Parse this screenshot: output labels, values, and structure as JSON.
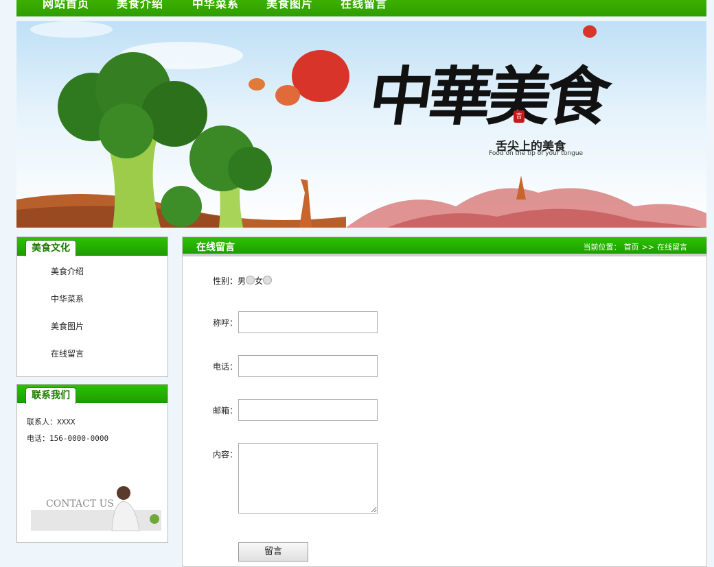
{
  "nav": {
    "items": [
      {
        "label": "网站首页"
      },
      {
        "label": "美食介绍"
      },
      {
        "label": "中华菜系"
      },
      {
        "label": "美食图片"
      },
      {
        "label": "在线留言"
      }
    ]
  },
  "banner": {
    "title": "中華美食",
    "subtitle": "舌尖上的美食",
    "tagline": "Food on the tip of your tongue",
    "seal": "吉"
  },
  "sidebar": {
    "culture": {
      "title": "美食文化",
      "items": [
        {
          "label": "美食介绍"
        },
        {
          "label": "中华菜系"
        },
        {
          "label": "美食图片"
        },
        {
          "label": "在线留言"
        }
      ]
    },
    "contact": {
      "title": "联系我们",
      "person": "联系人：XXXX",
      "phone": "电话：156-0000-0000",
      "image_text": "CONTACT US"
    }
  },
  "main": {
    "title": "在线留言",
    "breadcrumb": {
      "prefix": "当前位置：",
      "home": "首页",
      "sep": ">>",
      "current": "在线留言"
    },
    "form": {
      "gender_label": "性别：",
      "gender_male": "男",
      "gender_female": "女",
      "name_label": "称呼：",
      "name_value": "",
      "phone_label": "电话：",
      "phone_value": "",
      "email_label": "邮箱：",
      "email_value": "",
      "content_label": "内容：",
      "content_value": "",
      "submit_label": "留言"
    }
  },
  "colors": {
    "brand_green": "#2fa800",
    "nav_text": "#ffffff"
  }
}
